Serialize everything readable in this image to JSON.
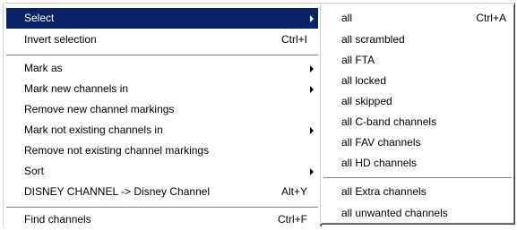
{
  "main_menu": {
    "items": [
      {
        "label": "Select",
        "shortcut": "",
        "has_submenu": true,
        "highlighted": true
      },
      {
        "label": "Invert selection",
        "shortcut": "Ctrl+I",
        "has_submenu": false
      },
      {
        "label": "Mark as",
        "shortcut": "",
        "has_submenu": true
      },
      {
        "label": "Mark new channels in",
        "shortcut": "",
        "has_submenu": true
      },
      {
        "label": "Remove new channel markings",
        "shortcut": "",
        "has_submenu": false
      },
      {
        "label": "Mark not existing channels in",
        "shortcut": "",
        "has_submenu": true
      },
      {
        "label": "Remove not existing channel markings",
        "shortcut": "",
        "has_submenu": false
      },
      {
        "label": "Sort",
        "shortcut": "",
        "has_submenu": true
      },
      {
        "label": "DISNEY CHANNEL -> Disney Channel",
        "shortcut": "Alt+Y",
        "has_submenu": false
      },
      {
        "label": "Find channels",
        "shortcut": "Ctrl+F",
        "has_submenu": false
      }
    ]
  },
  "select_submenu": {
    "items": [
      {
        "label": "all",
        "shortcut": "Ctrl+A"
      },
      {
        "label": "all scrambled",
        "shortcut": ""
      },
      {
        "label": "all FTA",
        "shortcut": ""
      },
      {
        "label": "all locked",
        "shortcut": ""
      },
      {
        "label": "all skipped",
        "shortcut": ""
      },
      {
        "label": "all C-band channels",
        "shortcut": ""
      },
      {
        "label": "all FAV channels",
        "shortcut": ""
      },
      {
        "label": "all HD channels",
        "shortcut": ""
      },
      {
        "label": "all Extra channels",
        "shortcut": ""
      },
      {
        "label": "all unwanted channels",
        "shortcut": ""
      }
    ]
  },
  "colors": {
    "highlight_bg": "#0a246a",
    "highlight_text": "#ffffff",
    "menu_bg": "#ffffff"
  }
}
